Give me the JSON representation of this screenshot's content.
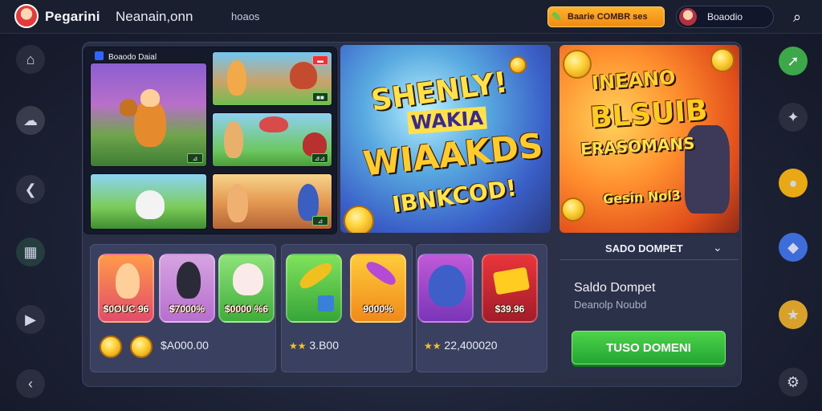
{
  "header": {
    "brand_title": "Pegarini",
    "brand_subtitle": "Neanain,onn",
    "nav_link": "hoaos",
    "promo_label": "Baarie COMBR ses",
    "profile_name": "Boaodio"
  },
  "hero_grid": {
    "header_label": "Boaodo Daial",
    "tiles": [
      {
        "badge": "⊿"
      },
      {
        "badge": "■■"
      },
      {
        "badge": "⊿⊿"
      },
      {
        "badge": ""
      },
      {
        "badge": "⊿"
      }
    ]
  },
  "banner_a": {
    "line1": "SHENLY!",
    "line2": "WAKIA",
    "line3": "WIAAKDS",
    "line4": "IBNKCOD!"
  },
  "banner_b": {
    "line1": "INEANO",
    "line2": "BLSUIB",
    "line3": "ERASOMANS",
    "line4": "Gesin Nol3"
  },
  "cards": [
    {
      "items": [
        "$0OUC 96",
        "$7000%",
        "$0000 %6"
      ],
      "footer": "$A000.00"
    },
    {
      "items": [
        "",
        "9000%"
      ],
      "footer": "3.B00"
    },
    {
      "items": [
        "",
        "$39.96"
      ],
      "footer": "22,400020"
    }
  ],
  "wallet": {
    "header": "SADO DOMPET",
    "title": "Saldo Dompet",
    "subtitle": "Deanolp Noubd",
    "button": "TUSO DOMENI"
  },
  "icons": {
    "search": "search-icon",
    "home": "home-icon",
    "chat": "chat-icon",
    "back": "back-arrow-icon",
    "play": "play-icon",
    "share": "share-icon"
  }
}
